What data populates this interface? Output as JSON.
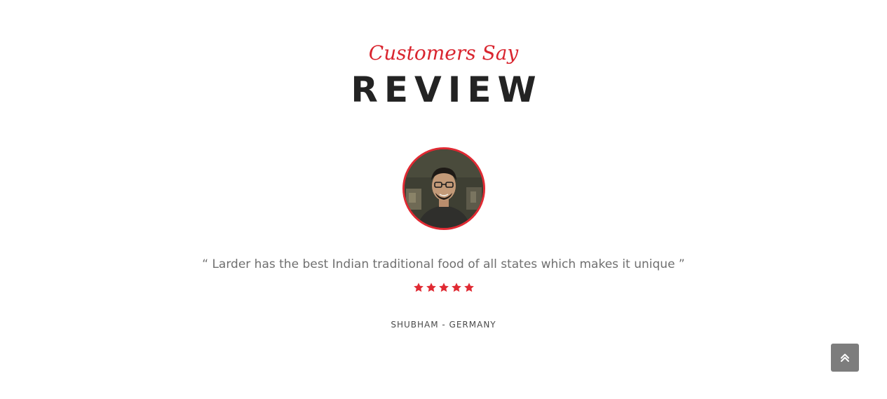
{
  "review": {
    "subtitle": "Customers Say",
    "title": "REVIEW",
    "quote": "“ Larder has the best Indian traditional food of all states which makes it unique ”",
    "rating": 5,
    "rating_max": 5,
    "author": "SHUBHAM - GERMANY"
  },
  "icons": {
    "star": "star-icon",
    "scroll_top": "double-chevron-up-icon"
  },
  "colors": {
    "accent": "#d9252f",
    "title": "#232323",
    "quote_text": "#6f6f6f",
    "scroll_button": "#7d7d7d"
  }
}
